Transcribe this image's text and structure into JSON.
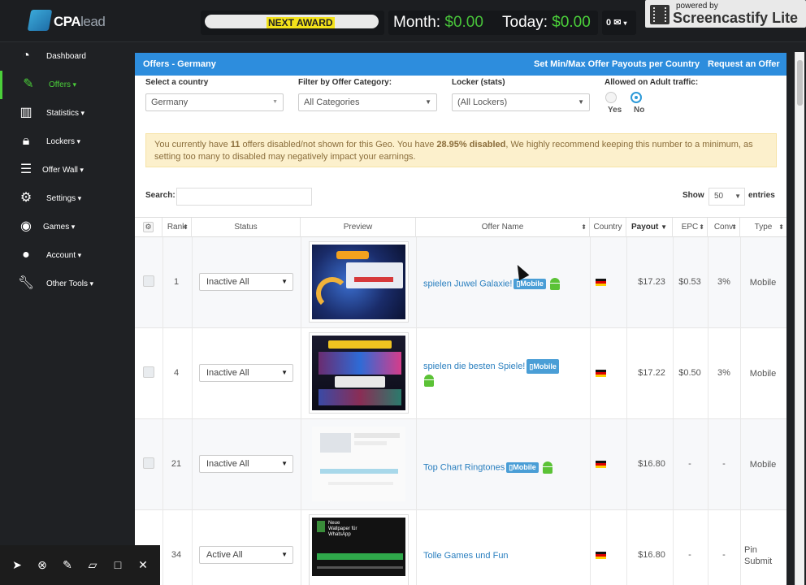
{
  "topbar": {
    "logo_text": "CPA",
    "logo_text2": "lead",
    "award_label": "NEXT AWARD",
    "month_label": "Month:",
    "month_value": "$0.00",
    "today_label": "Today:",
    "today_value": "$0.00",
    "mail_count": "0",
    "mail_icon": "envelope-icon",
    "castify_powered": "powered by",
    "castify_name": "Screencastify Lite"
  },
  "sidebar": {
    "items": [
      {
        "label": "Dashboard",
        "icon": "dashboard-icon"
      },
      {
        "label": "Offers",
        "icon": "edit-icon"
      },
      {
        "label": "Statistics",
        "icon": "bar-chart-icon"
      },
      {
        "label": "Lockers",
        "icon": "lock-icon"
      },
      {
        "label": "Offer Wall",
        "icon": "list-icon"
      },
      {
        "label": "Settings",
        "icon": "gears-icon"
      },
      {
        "label": "Games",
        "icon": "gamepad-icon"
      },
      {
        "label": "Account",
        "icon": "user-icon"
      },
      {
        "label": "Other Tools",
        "icon": "wrench-icon"
      }
    ]
  },
  "panel": {
    "title": "Offers - Germany",
    "link1": "Set Min/Max Offer Payouts per Country",
    "link2": "Request an Offer"
  },
  "filters": {
    "country_label": "Select a country",
    "country_value": "Germany",
    "category_label": "Filter by Offer Category:",
    "category_value": "All Categories",
    "locker_label": "Locker (stats)",
    "locker_value": "(All Lockers)",
    "adult_label": "Allowed on Adult traffic:",
    "yes_label": "Yes",
    "no_label": "No"
  },
  "alert": {
    "p1": "You currently have ",
    "count": "11",
    "p2": " offers disabled/not shown for this Geo. You have ",
    "pct": "28.95% disabled",
    "p3": ", We highly recommend keeping this number to a minimum, as setting too many to disabled may negatively impact your earnings."
  },
  "table_controls": {
    "search_label": "Search:",
    "show_label": "Show",
    "show_value": "50",
    "entries_label": "entries"
  },
  "columns": [
    "Rank",
    "Status",
    "Preview",
    "Offer Name",
    "Country",
    "Payout",
    "EPC",
    "Conv",
    "Type"
  ],
  "rows": [
    {
      "rank": "1",
      "status": "Inactive All",
      "name": "spielen Juwel Galaxie!",
      "badge": "Mobile",
      "payout": "$17.23",
      "epc": "$0.53",
      "conv": "3%",
      "type": "Mobile"
    },
    {
      "rank": "4",
      "status": "Inactive All",
      "name": "spielen die besten Spiele!",
      "badge": "Mobile",
      "payout": "$17.22",
      "epc": "$0.50",
      "conv": "3%",
      "type": "Mobile"
    },
    {
      "rank": "21",
      "status": "Inactive All",
      "name": "Top Chart Ringtones",
      "badge": "Mobile",
      "payout": "$16.80",
      "epc": "-",
      "conv": "-",
      "type": "Mobile"
    },
    {
      "rank": "34",
      "status": "Active All",
      "name": "Tolle Games und Fun",
      "badge": "",
      "payout": "$16.80",
      "epc": "-",
      "conv": "-",
      "type": "Pin Submit"
    }
  ],
  "preview4_text": {
    "title": "Neue Wallpaper für WhatsApp"
  }
}
